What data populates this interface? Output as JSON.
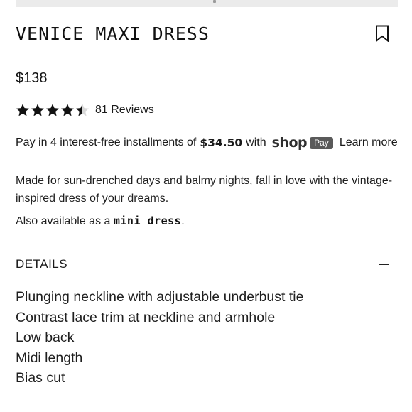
{
  "product": {
    "title": "VENICE MAXI DRESS",
    "price": "$138",
    "rating": 4.5,
    "reviews_label": "81 Reviews"
  },
  "installments": {
    "prefix": "Pay in 4 interest-free installments of",
    "amount": "$34.50",
    "suffix": "with",
    "shop_logo": "shop",
    "pay_badge": "Pay",
    "learn_more": "Learn more"
  },
  "description": {
    "text": "Made for sun-drenched days and balmy nights, fall in love with the vintage-inspired dress of your dreams.",
    "also_prefix": "Also available as a",
    "also_link": "mini dress",
    "also_suffix": "."
  },
  "details": {
    "title": "DETAILS",
    "items": [
      "Plunging neckline with adjustable underbust tie",
      "Contrast lace trim at neckline and armhole",
      "Low back",
      "Midi length",
      "Bias cut"
    ]
  },
  "icons": {
    "bookmark": "bookmark-icon",
    "star": "star-icon",
    "collapse": "minus-icon"
  },
  "colors": {
    "text": "#1a1a1a",
    "star": "#111111",
    "pay_badge": "#5a5a5a",
    "divider": "#d6d6d6"
  }
}
